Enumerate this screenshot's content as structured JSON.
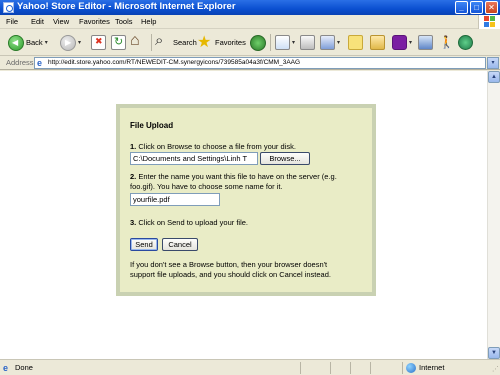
{
  "window": {
    "title": "Yahoo! Store Editor - Microsoft Internet Explorer",
    "minimize": "_",
    "maximize": "□",
    "close": "✕"
  },
  "menu": [
    "File",
    "Edit",
    "View",
    "Favorites",
    "Tools",
    "Help"
  ],
  "toolbar": {
    "back": "Back",
    "search": "Search",
    "favorites": "Favorites",
    "dropdown_glyph": "▾"
  },
  "address": {
    "label": "Address",
    "url": "http://edit.store.yahoo.com/RT/NEWEDIT-CM.synergyicons/739585a04a3f/CMM_3AAG"
  },
  "upload": {
    "heading": "File Upload",
    "step1_num": "1.",
    "step1_text": "Click on Browse to choose a file from your disk.",
    "file_path_value": "C:\\Documents and Settings\\Linh T",
    "browse_label": "Browse...",
    "step2_num": "2.",
    "step2_line1": "Enter the name you want this file to have on the server (e.g.",
    "step2_line2": "foo.gif).  You have to choose some name for it.",
    "filename_value": "yourfile.pdf",
    "step3_num": "3.",
    "step3_text": "Click on Send to upload your file.",
    "send_label": "Send",
    "cancel_label": "Cancel",
    "note_line1": "If you don't see a Browse button, then your browser doesn't",
    "note_line2": "support file uploads, and you should click on Cancel instead."
  },
  "status": {
    "text": "Done",
    "zone": "Internet"
  },
  "colors": {
    "titlebar": "#0a4fd0",
    "panel_bg": "#e9ecc6",
    "panel_border": "#c9d1b2"
  }
}
